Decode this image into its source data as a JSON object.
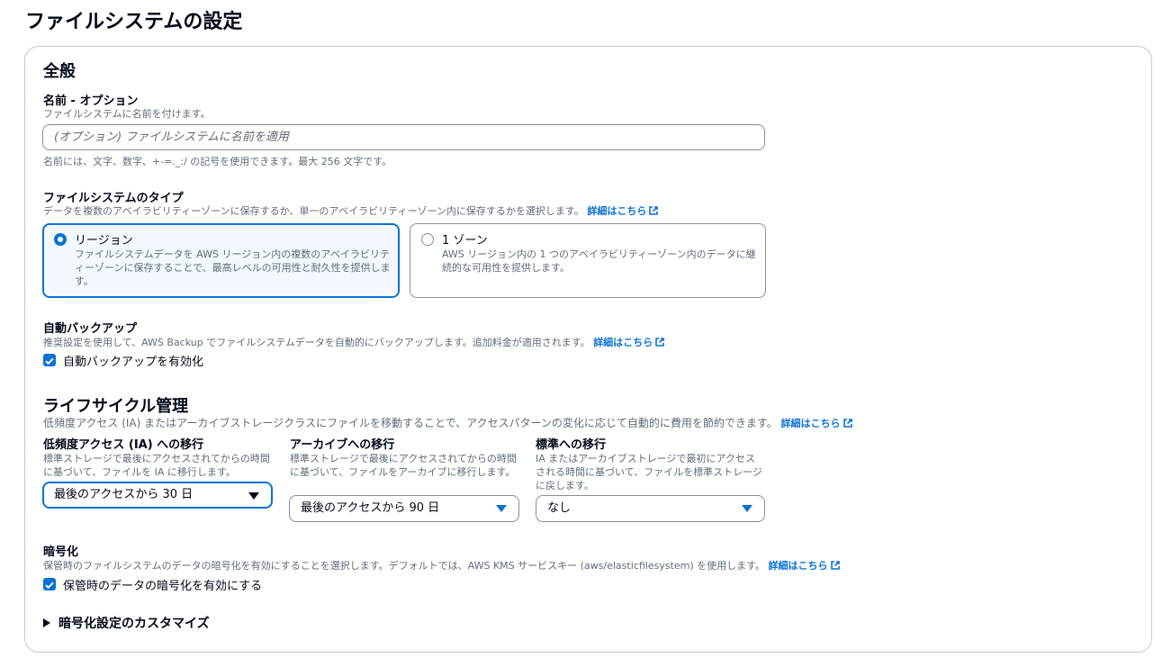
{
  "page": {
    "title": "ファイルシステムの設定"
  },
  "general": {
    "heading": "全般",
    "name": {
      "label": "名前 - オプション",
      "description": "ファイルシステムに名前を付けます。",
      "placeholder": "(オプション) ファイルシステムに名前を適用",
      "value": "",
      "constraint": "名前には、文字、数字、+-=._:/ の記号を使用できます。最大 256 文字です。"
    },
    "fs_type": {
      "label": "ファイルシステムのタイプ",
      "description": "データを複数のアベイラビリティーゾーンに保存するか、単一のアベイラビリティーゾーン内に保存するかを選択します。",
      "link": "詳細はこちら",
      "options": [
        {
          "title": "リージョン",
          "description": "ファイルシステムデータを AWS リージョン内の複数のアベイラビリティーゾーンに保存することで、最高レベルの可用性と耐久性を提供します。",
          "selected": true
        },
        {
          "title": "1 ゾーン",
          "description": "AWS リージョン内の 1 つのアベイラビリティーゾーン内のデータに継続的な可用性を提供します。",
          "selected": false
        }
      ]
    },
    "backup": {
      "label": "自動バックアップ",
      "description": "推奨設定を使用して、AWS Backup でファイルシステムデータを自動的にバックアップします。追加料金が適用されます。",
      "link": "詳細はこちら",
      "checkbox_label": "自動バックアップを有効化",
      "checked": true
    }
  },
  "lifecycle": {
    "heading": "ライフサイクル管理",
    "description": "低頻度アクセス (IA) またはアーカイブストレージクラスにファイルを移動することで、アクセスパターンの変化に応じて自動的に費用を節約できます。",
    "link": "詳細はこちら",
    "columns": [
      {
        "label": "低頻度アクセス (IA) への移行",
        "description": "標準ストレージで最後にアクセスされてからの時間に基づいて、ファイルを IA に移行します。",
        "value": "最後のアクセスから 30 日"
      },
      {
        "label": "アーカイブへの移行",
        "description": "標準ストレージで最後にアクセスされてからの時間に基づいて、ファイルをアーカイブに移行します。",
        "value": "最後のアクセスから 90 日"
      },
      {
        "label": "標準への移行",
        "description": "IA またはアーカイブストレージで最初にアクセスされる時間に基づいて、ファイルを標準ストレージに戻します。",
        "value": "なし"
      }
    ]
  },
  "encryption": {
    "label": "暗号化",
    "description": "保管時のファイルシステムのデータの暗号化を有効にすることを選択します。デフォルトでは、AWS KMS サービスキー (aws/elasticfilesystem) を使用します。",
    "link": "詳細はこちら",
    "checkbox_label": "保管時のデータの暗号化を有効にする",
    "checked": true,
    "expander_label": "暗号化設定のカスタマイズ"
  },
  "colors": {
    "accent": "#0972d3",
    "text": "#000716",
    "muted": "#5f6b7a",
    "border": "#8c8c94",
    "selected_bg": "#f2f8fd"
  }
}
